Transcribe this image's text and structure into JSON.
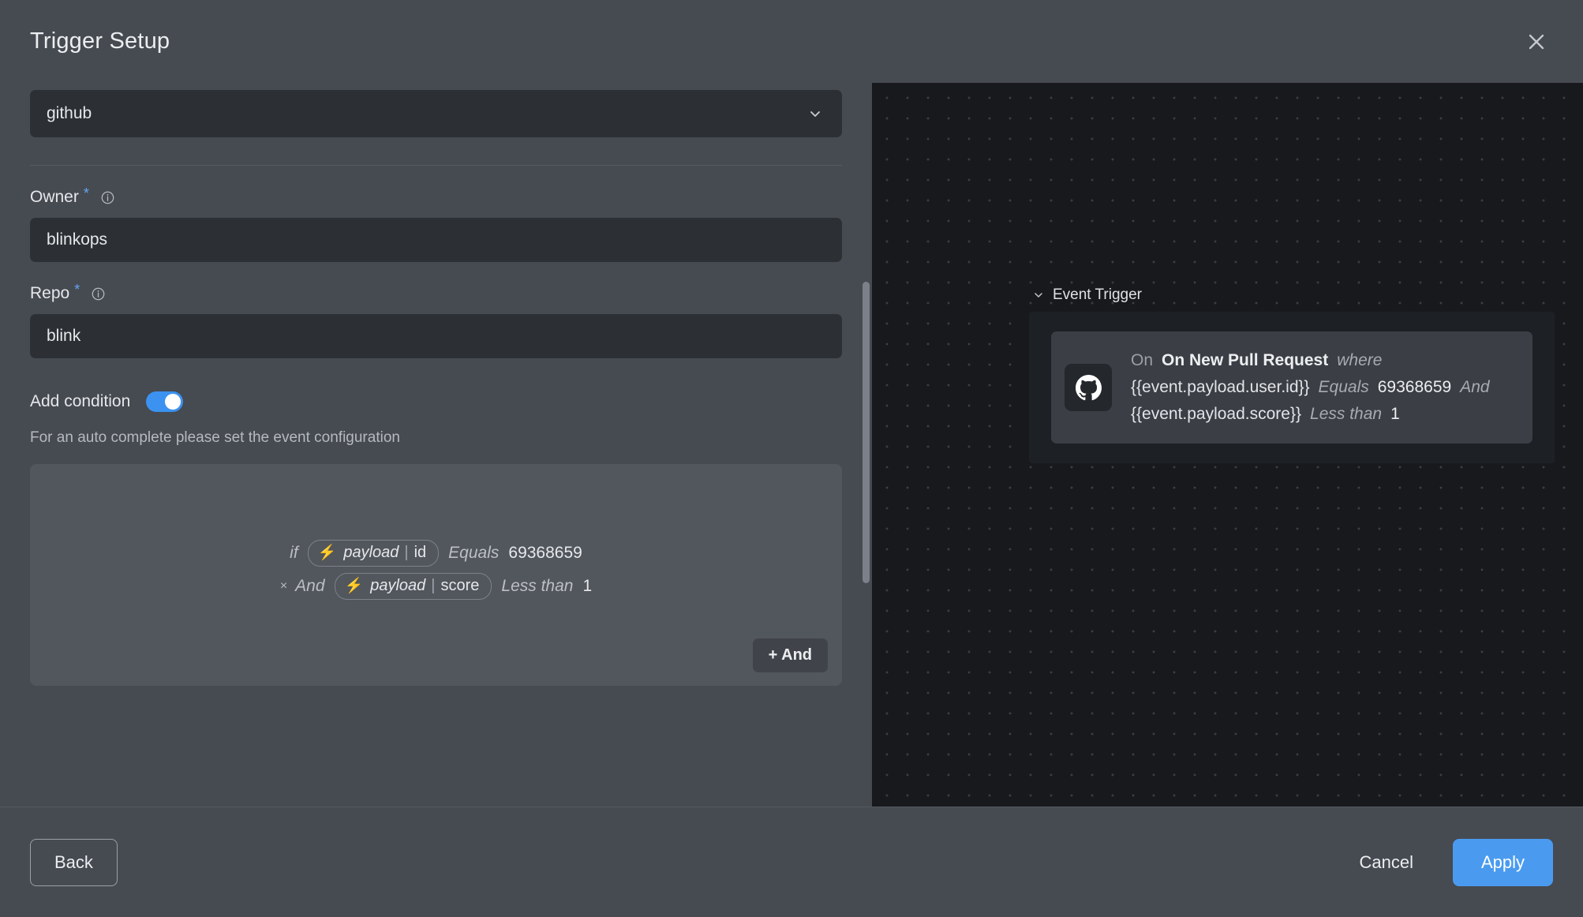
{
  "header": {
    "title": "Trigger Setup",
    "close_icon": "close-icon"
  },
  "form": {
    "integration_select": {
      "value": "github",
      "chevron_icon": "chevron-down-icon"
    },
    "fields": [
      {
        "label": "Owner",
        "required_marker": "*",
        "info_icon": "info-icon",
        "value": "blinkops"
      },
      {
        "label": "Repo",
        "required_marker": "*",
        "info_icon": "info-icon",
        "value": "blink"
      }
    ],
    "add_condition": {
      "label": "Add condition",
      "enabled": true
    },
    "hint": "For an auto complete please set the event configuration",
    "conditions": {
      "rows": [
        {
          "prefix": "if",
          "remove_icon": "",
          "chip": {
            "icon": "lightning-bolt-icon",
            "source": "payload",
            "separator": "|",
            "key": "id"
          },
          "operator": "Equals",
          "value": "69368659"
        },
        {
          "prefix": "And",
          "remove_icon": "×",
          "chip": {
            "icon": "lightning-bolt-icon",
            "source": "payload",
            "separator": "|",
            "key": "score"
          },
          "operator": "Less than",
          "value": "1"
        }
      ],
      "add_and_label": "+ And"
    }
  },
  "canvas": {
    "group_label": "Event Trigger",
    "group_chevron_icon": "chevron-down-icon",
    "node": {
      "app_icon": "github-icon",
      "on_label": "On",
      "event_name": "On New Pull Request",
      "where_label": "where",
      "conditions": [
        {
          "expression": "{{event.payload.user.id}}",
          "operator": "Equals",
          "value": "69368659",
          "conjunction": "And"
        },
        {
          "expression": "{{event.payload.score}}",
          "operator": "Less than",
          "value": "1",
          "conjunction": ""
        }
      ]
    }
  },
  "footer": {
    "back_label": "Back",
    "cancel_label": "Cancel",
    "apply_label": "Apply"
  },
  "colors": {
    "accent": "#4a9bf0",
    "toggle_on": "#3b92f0",
    "required_star": "#64a6f0",
    "bolt": "#f2c14e",
    "panel_bg": "#464a51",
    "canvas_bg": "#17191d"
  }
}
